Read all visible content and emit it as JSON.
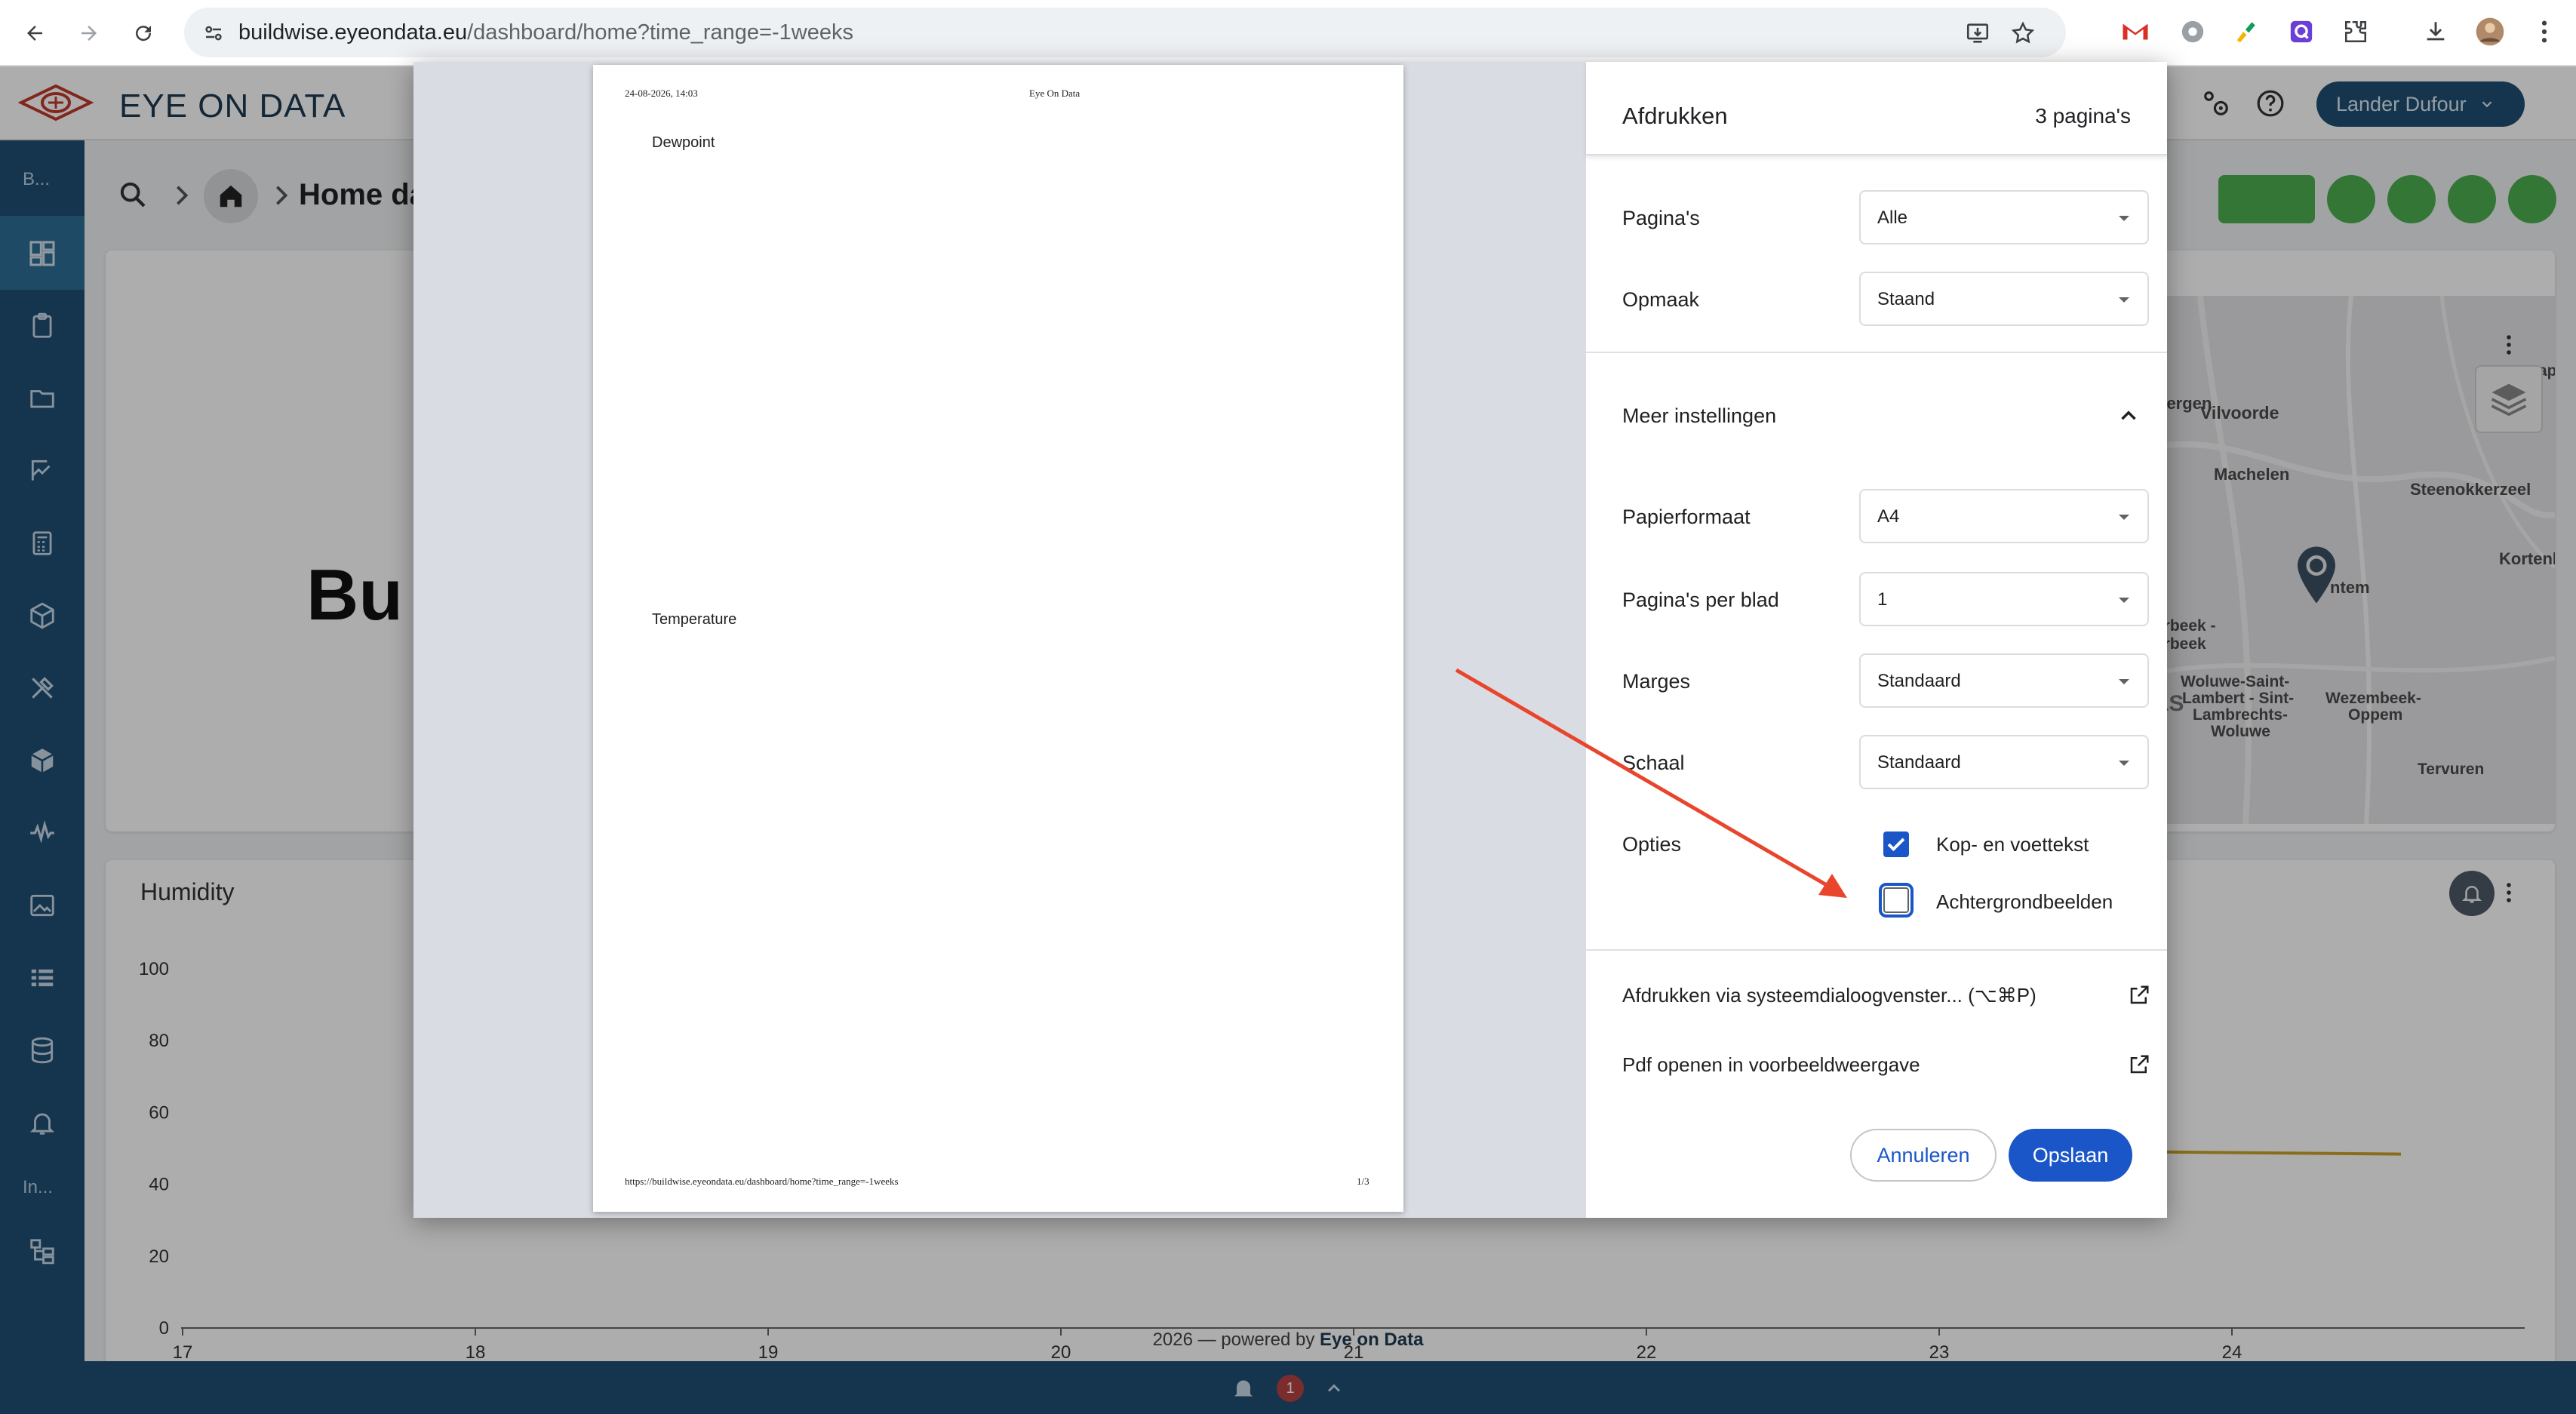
{
  "browser": {
    "url_host": "buildwise.eyeondata.eu",
    "url_path": "/dashboard/home?time_range=-1weeks"
  },
  "app": {
    "brand": "EYE ON DATA",
    "breadcrumb_title": "Home da",
    "user_menu_label": "Lander Dufour",
    "sidebar_top_text": "B...",
    "sidebar_bottom_text": "In...",
    "logo_partial_text": "Bu",
    "footer_text_prefix": "2026 — powered by ",
    "footer_text_brand": "Eye on Data",
    "notification_count": "1",
    "accent": "#1e4f72",
    "fab_green": "#4caf50"
  },
  "map": {
    "labels": [
      "bergen",
      "Vilvoorde",
      "Machelen",
      "Steenokkerzeel",
      "Kortenb",
      "ntem",
      "erbeek -",
      "arbeek",
      "LS",
      "Woluwe-Saint-",
      "Lambert - Sint-",
      "Lambrechts-",
      "Woluwe",
      "Wezembeek-",
      "Oppem",
      "Tervuren",
      "ap"
    ]
  },
  "chart": {
    "title": "Humidity",
    "y_ticks": [
      "100",
      "80",
      "60",
      "40",
      "20",
      "0"
    ],
    "x_ticks": [
      "17",
      "18",
      "19",
      "20",
      "21",
      "22",
      "23",
      "24"
    ]
  },
  "chart_data": {
    "type": "line",
    "title": "Humidity",
    "xlabel": "",
    "ylabel": "",
    "ylim": [
      0,
      100
    ],
    "categories": [
      "17",
      "18",
      "19",
      "20",
      "21",
      "22",
      "23",
      "24"
    ],
    "grid": false
  },
  "print_preview": {
    "header_date": "24-08-2026, 14:03",
    "header_title": "Eye On Data",
    "section1": "Dewpoint",
    "section2": "Temperature",
    "footer_url": "https://buildwise.eyeondata.eu/dashboard/home?time_range=-1weeks",
    "footer_page": "1/3"
  },
  "print_dialog": {
    "title": "Afdrukken",
    "page_count": "3 pagina's",
    "rows": {
      "pages": {
        "label": "Pagina's",
        "value": "Alle"
      },
      "layout": {
        "label": "Opmaak",
        "value": "Staand"
      },
      "more_settings": {
        "label": "Meer instellingen"
      },
      "paper": {
        "label": "Papierformaat",
        "value": "A4"
      },
      "pages_per_sheet": {
        "label": "Pagina's per blad",
        "value": "1"
      },
      "margins": {
        "label": "Marges",
        "value": "Standaard"
      },
      "scale": {
        "label": "Schaal",
        "value": "Standaard"
      },
      "options": {
        "label": "Opties"
      }
    },
    "options": {
      "headers_footers": {
        "label": "Kop- en voettekst",
        "checked": true
      },
      "backgrounds": {
        "label": "Achtergrondbeelden",
        "checked": false
      }
    },
    "system_dialog_link": "Afdrukken via systeemdialoogvenster... (⌥⌘P)",
    "open_pdf_link": "Pdf openen in voorbeeldweergave",
    "cancel_label": "Annuleren",
    "save_label": "Opslaan",
    "primary_color": "#1a56c8"
  }
}
